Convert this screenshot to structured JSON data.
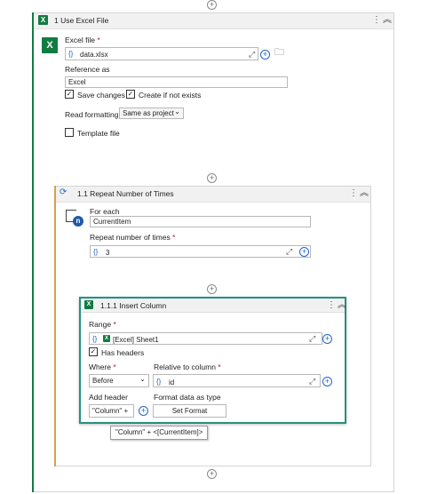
{
  "colors": {
    "green_accent": "#107c41",
    "teal_accent": "#23927f",
    "orange_accent": "#d79f50",
    "required": "#c50f1f"
  },
  "use_excel_file": {
    "title": "1  Use Excel File",
    "excel_file_label": "Excel file",
    "excel_file_value": "data.xlsx",
    "reference_as_label": "Reference as",
    "reference_as_value": "Excel",
    "save_changes_label": "Save changes",
    "create_if_not_exists_label": "Create if not exists",
    "read_formatting_label": "Read formatting",
    "read_formatting_value": "Same as project",
    "template_file_label": "Template file"
  },
  "repeat": {
    "title": "1.1  Repeat Number of Times",
    "for_each_label": "For each",
    "for_each_value": "CurrentItem",
    "repeat_number_label": "Repeat number of times",
    "repeat_number_value": "3"
  },
  "insert_column": {
    "title": "1.1.1  Insert Column",
    "range_label": "Range",
    "range_value": "[Excel] Sheet1",
    "has_headers_label": "Has headers",
    "where_label": "Where",
    "where_value": "Before",
    "relative_to_column_label": "Relative to column",
    "relative_to_column_value": "id",
    "add_header_label": "Add header",
    "add_header_value": "\"Column\" +",
    "format_data_label": "Format data as type",
    "set_format_label": "Set Format"
  },
  "tooltip": "\"Column\" + <[CurrentItem]>",
  "common": {
    "required_mark": "*",
    "var_icon": "{}",
    "plus": "+",
    "expand_icon": "⤢",
    "check": "✓",
    "dots": "⋮",
    "collapse": "︽",
    "chevron_down": "⌄",
    "folder": "🗀"
  }
}
